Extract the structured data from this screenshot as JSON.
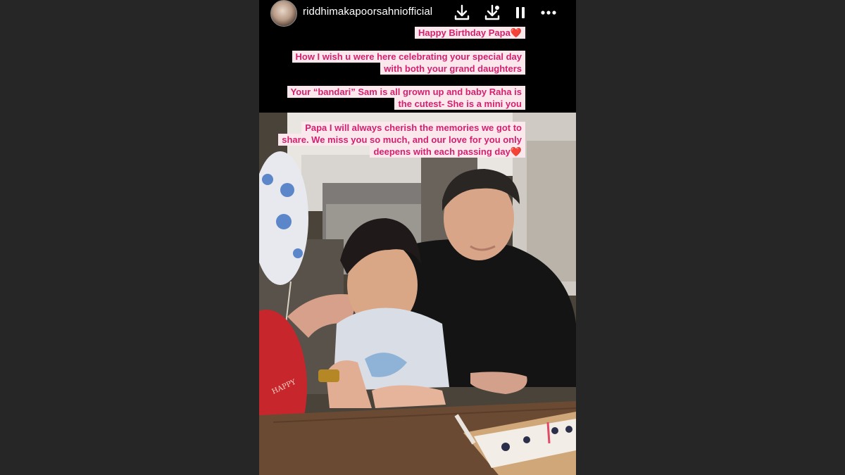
{
  "header": {
    "username": "riddhimakapoorsahniofficial",
    "icons": [
      "download-icon",
      "save-icon",
      "pause-icon",
      "more-icon"
    ]
  },
  "captions": [
    {
      "lines": [
        "Happy Birthday Papa❤️"
      ]
    },
    {
      "lines": [
        "How I wish u were here celebrating your special day",
        "with both your grand daughters"
      ]
    },
    {
      "lines": [
        "Your “bandari” Sam  is all grown up and baby Raha is",
        "the cutest- She is  a mini you"
      ]
    },
    {
      "lines": [
        "Papa I will always  cherish the memories we got to",
        "share. We miss you so much, and our love for you only",
        "deepens with each passing day❤️"
      ]
    }
  ],
  "colors": {
    "caption_text": "#d4206f",
    "caption_bg": "#fbe8ec",
    "story_bg": "#000000",
    "page_bg": "#262626"
  }
}
